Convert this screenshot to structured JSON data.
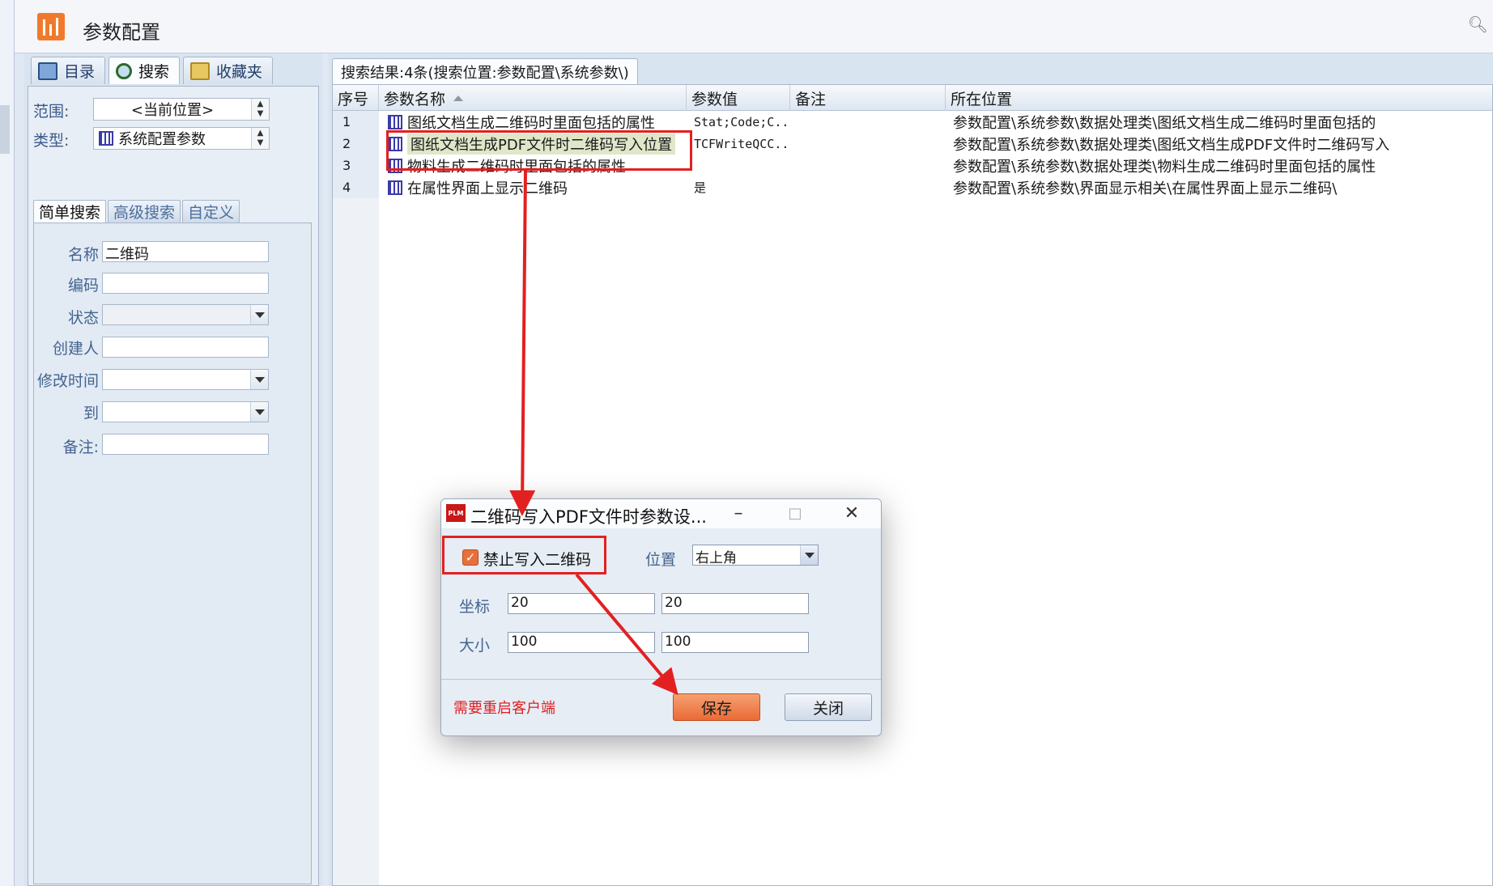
{
  "app": {
    "title": "参数配置"
  },
  "left_tabs": [
    "目录",
    "搜索",
    "收藏夹"
  ],
  "scope": {
    "label": "范围:",
    "value": "<当前位置>"
  },
  "type": {
    "label": "类型:",
    "value": "系统配置参数"
  },
  "sub_tabs": [
    "简单搜索",
    "高级搜索",
    "自定义"
  ],
  "search_fields": {
    "name_label": "名称",
    "name_value": "二维码",
    "code_label": "编码",
    "code_value": "",
    "status_label": "状态",
    "status_value": "",
    "creator_label": "创建人",
    "creator_value": "",
    "modified_label": "修改时间",
    "modified_value": "",
    "to_label": "到",
    "to_value": "",
    "note_label": "备注:",
    "note_value": ""
  },
  "results": {
    "tab_label": "搜索结果:4条(搜索位置:参数配置\\系统参数\\)",
    "columns": [
      "序号",
      "参数名称",
      "参数值",
      "备注",
      "所在位置"
    ],
    "rows": [
      {
        "idx": "1",
        "name": "图纸文档生成二维码时里面包括的属性",
        "value": "Stat;Code;C...",
        "note": "",
        "location": "参数配置\\系统参数\\数据处理类\\图纸文档生成二维码时里面包括的"
      },
      {
        "idx": "2",
        "name": "图纸文档生成PDF文件时二维码写入位置",
        "value": "TCFWriteQCC...",
        "note": "",
        "location": "参数配置\\系统参数\\数据处理类\\图纸文档生成PDF文件时二维码写入"
      },
      {
        "idx": "3",
        "name": "物料生成二维码时里面包括的属性",
        "value": "",
        "note": "",
        "location": "参数配置\\系统参数\\数据处理类\\物料生成二维码时里面包括的属性"
      },
      {
        "idx": "4",
        "name": "在属性界面上显示二维码",
        "value": "是",
        "note": "",
        "location": "参数配置\\系统参数\\界面显示相关\\在属性界面上显示二维码\\"
      }
    ]
  },
  "dialog": {
    "icon_text": "PLM",
    "title": "二维码写入PDF文件时参数设...",
    "checkbox_label": "禁止写入二维码",
    "checkbox_checked": true,
    "position_label": "位置",
    "position_value": "右上角",
    "coord_label": "坐标",
    "coord_x": "20",
    "coord_y": "20",
    "size_label": "大小",
    "size_w": "100",
    "size_h": "100",
    "warning": "需要重启客户端",
    "save_label": "保存",
    "close_label": "关闭"
  },
  "colors": {
    "accent": "#f07a2c",
    "annotation": "#e32020",
    "save_button": "#ea6a36",
    "warning_text": "#e02020"
  }
}
